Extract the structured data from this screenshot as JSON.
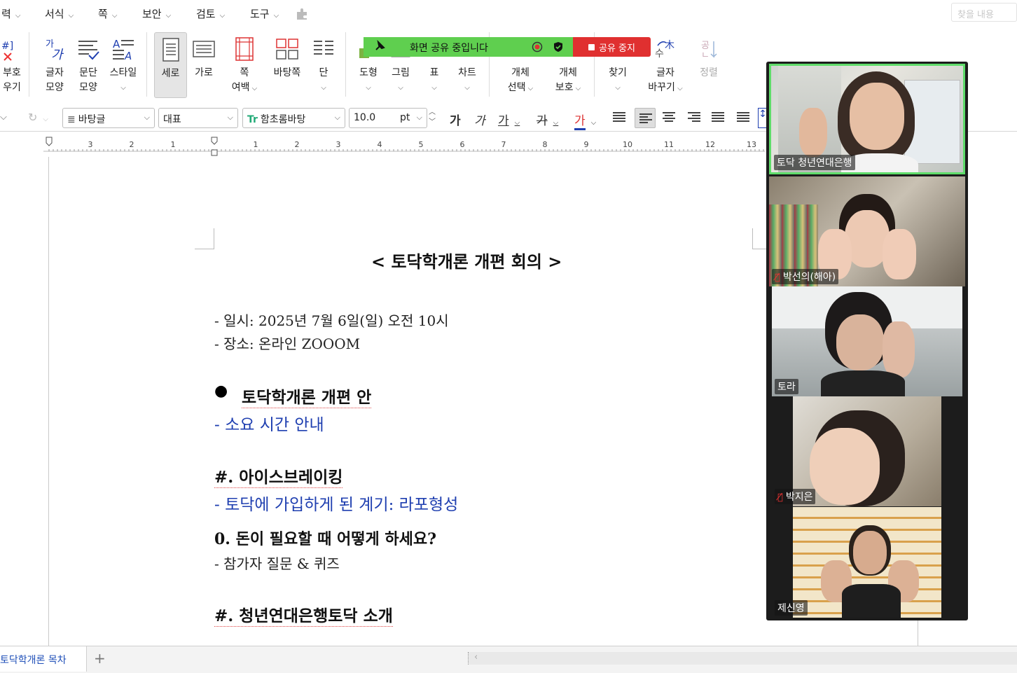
{
  "menubar": {
    "items": [
      {
        "label": "력",
        "has_arrow": true
      },
      {
        "label": "서식",
        "has_arrow": true
      },
      {
        "label": "쪽",
        "has_arrow": true
      },
      {
        "label": "보안",
        "has_arrow": true
      },
      {
        "label": "검토",
        "has_arrow": true
      },
      {
        "label": "도구",
        "has_arrow": true
      }
    ],
    "find_placeholder": "찾을 내용"
  },
  "ribbon": {
    "symbol_label_1": "부호",
    "symbol_label_2": "우기",
    "char_shape_1": "글자",
    "char_shape_2": "모양",
    "para_shape_1": "문단",
    "para_shape_2": "모양",
    "style_label": "스타일",
    "vertical_label": "세로",
    "horizontal_label": "가로",
    "page_margin_1": "쪽",
    "page_margin_2": "여백",
    "master_page_label": "바탕쪽",
    "column_label": "단",
    "shape_label": "도형",
    "picture_label": "그림",
    "table_label": "표",
    "chart_label": "차트",
    "obj_select_1": "개체",
    "obj_select_2": "선택",
    "obj_protect_1": "개체",
    "obj_protect_2": "보호",
    "find_label": "찾기",
    "replace_1": "글자",
    "replace_2": "바꾸기",
    "sort_label": "정렬"
  },
  "sharebar": {
    "status": "화면 공유 중입니다",
    "stop": "공유 중지"
  },
  "formatbar": {
    "style_value": "바탕글",
    "lang_value": "대표",
    "font_value": "함초롬바탕",
    "size_value": "10.0",
    "size_unit": "pt",
    "bold_glyph": "가",
    "italic_glyph": "가",
    "underline_glyph": "가",
    "strike_glyph": "가",
    "color_glyph": "가"
  },
  "ruler": {
    "ticks": [
      "3",
      "2",
      "1",
      "1",
      "2",
      "3",
      "4",
      "5",
      "6",
      "7",
      "8",
      "9",
      "10",
      "11",
      "12",
      "13"
    ]
  },
  "document": {
    "title": "< 토닥학개론 개편 회의 >",
    "date_line": "- 일시: 2025년 7월 6일(일) 오전 10시",
    "place_line": "- 장소: 온라인 ZOOOM",
    "section1_bullet": "●",
    "section1_title": "토닥학개론 개편 안",
    "section1_sub": "- 소요 시간 안내",
    "section2_title": "#. 아이스브레이킹",
    "section2_sub": "- 토닥에 가입하게 된 계기: 라포형성",
    "q0_title": "0. 돈이 필요할 때 어떻게 하세요?",
    "q0_sub": "- 참가자 질문 & 퀴즈",
    "section3_title": "#. 청년연대은행토닥 소개"
  },
  "video": {
    "participants": [
      {
        "name": "토닥 청년연대은행",
        "muted": false,
        "active": true
      },
      {
        "name": "박선의(해아)",
        "muted": true,
        "active": false
      },
      {
        "name": "토라",
        "muted": false,
        "active": false
      },
      {
        "name": "박지은",
        "muted": true,
        "active": false
      },
      {
        "name": "제신영",
        "muted": false,
        "active": false
      }
    ]
  },
  "tabs": {
    "active_tab": "토닥학개론 목차",
    "add_tab": "+"
  },
  "colors": {
    "accent_blue": "#1f3fb0",
    "share_green": "#5fcf4f",
    "stop_red": "#e03030",
    "active_speaker": "#5fdc6a"
  }
}
